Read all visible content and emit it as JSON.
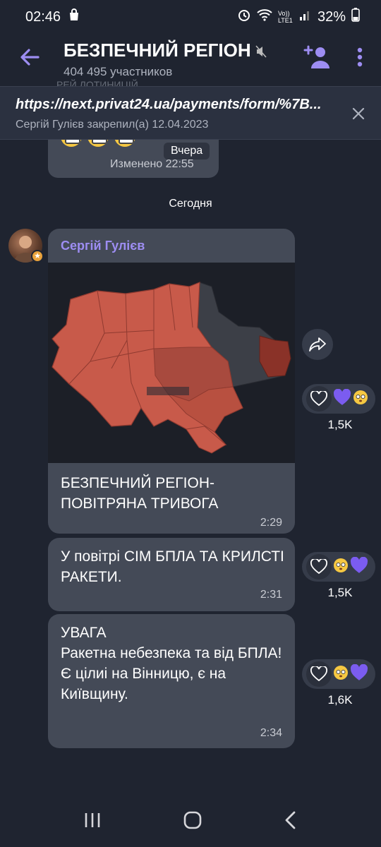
{
  "status_bar": {
    "time": "02:46",
    "network": "Vo)) LTE1",
    "battery": "32%"
  },
  "header": {
    "title": "БЕЗПЕЧНИЙ РЕГІОН",
    "members": "404 495 участников"
  },
  "pinned": {
    "url": "https://next.privat24.ua/payments/form/%7B...",
    "meta": "Сергій Гулієв закрепил(а) 12.04.2023"
  },
  "previous_message": {
    "ghost_text": "РЕЙ ЛОТИНИЦІЙ",
    "date_chip": "Вчера",
    "edited": "Изменено",
    "time": "22:55"
  },
  "day_separator": "Сегодня",
  "messages": [
    {
      "author": "Сергій Гулієв",
      "text": "БЕЗПЕЧНИЙ РЕГІОН-ПОВІТРЯНА ТРИВОГА",
      "time": "2:29",
      "reaction_count": "1,5K"
    },
    {
      "text": "У повітрі СІМ БПЛА ТА КРИЛСТІ РАКЕТИ.",
      "time": "2:31",
      "reaction_count": "1,5K"
    },
    {
      "text": "УВАГА\nРакетна небезпека та від БПЛА!\nЄ цілиі на Вінницю, є на Київщину.",
      "time": "2:34",
      "reaction_count": "1,6K"
    }
  ],
  "colors": {
    "accent": "#9d8df2",
    "bubble": "#444a57",
    "background": "#1f2430",
    "alert_region": "#c85a4a",
    "reaction_heart": "#7b5cf0"
  },
  "icons": [
    "back-arrow-icon",
    "mute-icon",
    "add-user-icon",
    "more-vert-icon",
    "close-icon",
    "share-icon",
    "heart-icon",
    "recent-apps-icon",
    "home-icon",
    "nav-back-icon"
  ]
}
